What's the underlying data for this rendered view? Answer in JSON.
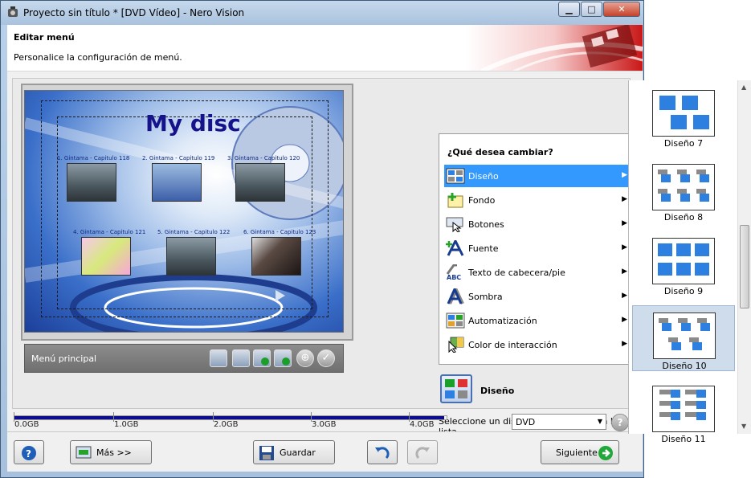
{
  "window": {
    "title": "Proyecto sin título * [DVD Vídeo] - Nero Vision",
    "minimize_glyph": "▁",
    "maximize_glyph": "□",
    "close_glyph": "✕"
  },
  "header": {
    "title": "Editar menú",
    "subtitle": "Personalice la configuración de menú."
  },
  "preview": {
    "disc_title": "My disc",
    "thumbnails": [
      {
        "label": "1. Gintama - Capitulo 118",
        "style": "storm"
      },
      {
        "label": "2. Gintama - Capitulo 119",
        "style": "person"
      },
      {
        "label": "3. Gintama - Capitulo 120",
        "style": "storm"
      },
      {
        "label": "4. Gintama - Capitulo 121",
        "style": "pink"
      },
      {
        "label": "5. Gintama - Capitulo 122",
        "style": "storm"
      },
      {
        "label": "6. Gintama - Capitulo 123",
        "style": "dark"
      }
    ],
    "menu_name": "Menú principal"
  },
  "change_menu": {
    "title": "¿Qué desea cambiar?",
    "items": [
      {
        "label": "Diseño",
        "icon": "layout-grid-icon",
        "selected": true
      },
      {
        "label": "Fondo",
        "icon": "background-icon",
        "selected": false
      },
      {
        "label": "Botones",
        "icon": "buttons-icon",
        "selected": false
      },
      {
        "label": "Fuente",
        "icon": "font-icon",
        "selected": false
      },
      {
        "label": "Texto de cabecera/pie",
        "icon": "header-text-icon",
        "selected": false
      },
      {
        "label": "Sombra",
        "icon": "shadow-icon",
        "selected": false
      },
      {
        "label": "Automatización",
        "icon": "automation-icon",
        "selected": false
      },
      {
        "label": "Color de interacción",
        "icon": "interaction-color-icon",
        "selected": false
      }
    ],
    "arrow_glyph": "▶"
  },
  "selection": {
    "title": "Diseño",
    "description": "Seleccione un diseño para el menú en la lista."
  },
  "layouts": [
    {
      "name": "Diseño 7",
      "selected": false
    },
    {
      "name": "Diseño 8",
      "selected": false
    },
    {
      "name": "Diseño 9",
      "selected": false
    },
    {
      "name": "Diseño 10",
      "selected": true
    },
    {
      "name": "Diseño 11",
      "selected": false
    }
  ],
  "capacity": {
    "ticks": [
      "0.0GB",
      "1.0GB",
      "2.0GB",
      "3.0GB",
      "4.0GB"
    ],
    "used_fraction": 0.995,
    "disc_type": "DVD",
    "dropdown_glyph": "▼"
  },
  "footer": {
    "help_glyph": "?",
    "more_label": "Más >>",
    "save_label": "Guardar",
    "next_label": "Siguiente"
  },
  "colors": {
    "selection": "#3399ff",
    "title_text": "#16128b",
    "capacity_fill": "#0b0d8e"
  }
}
